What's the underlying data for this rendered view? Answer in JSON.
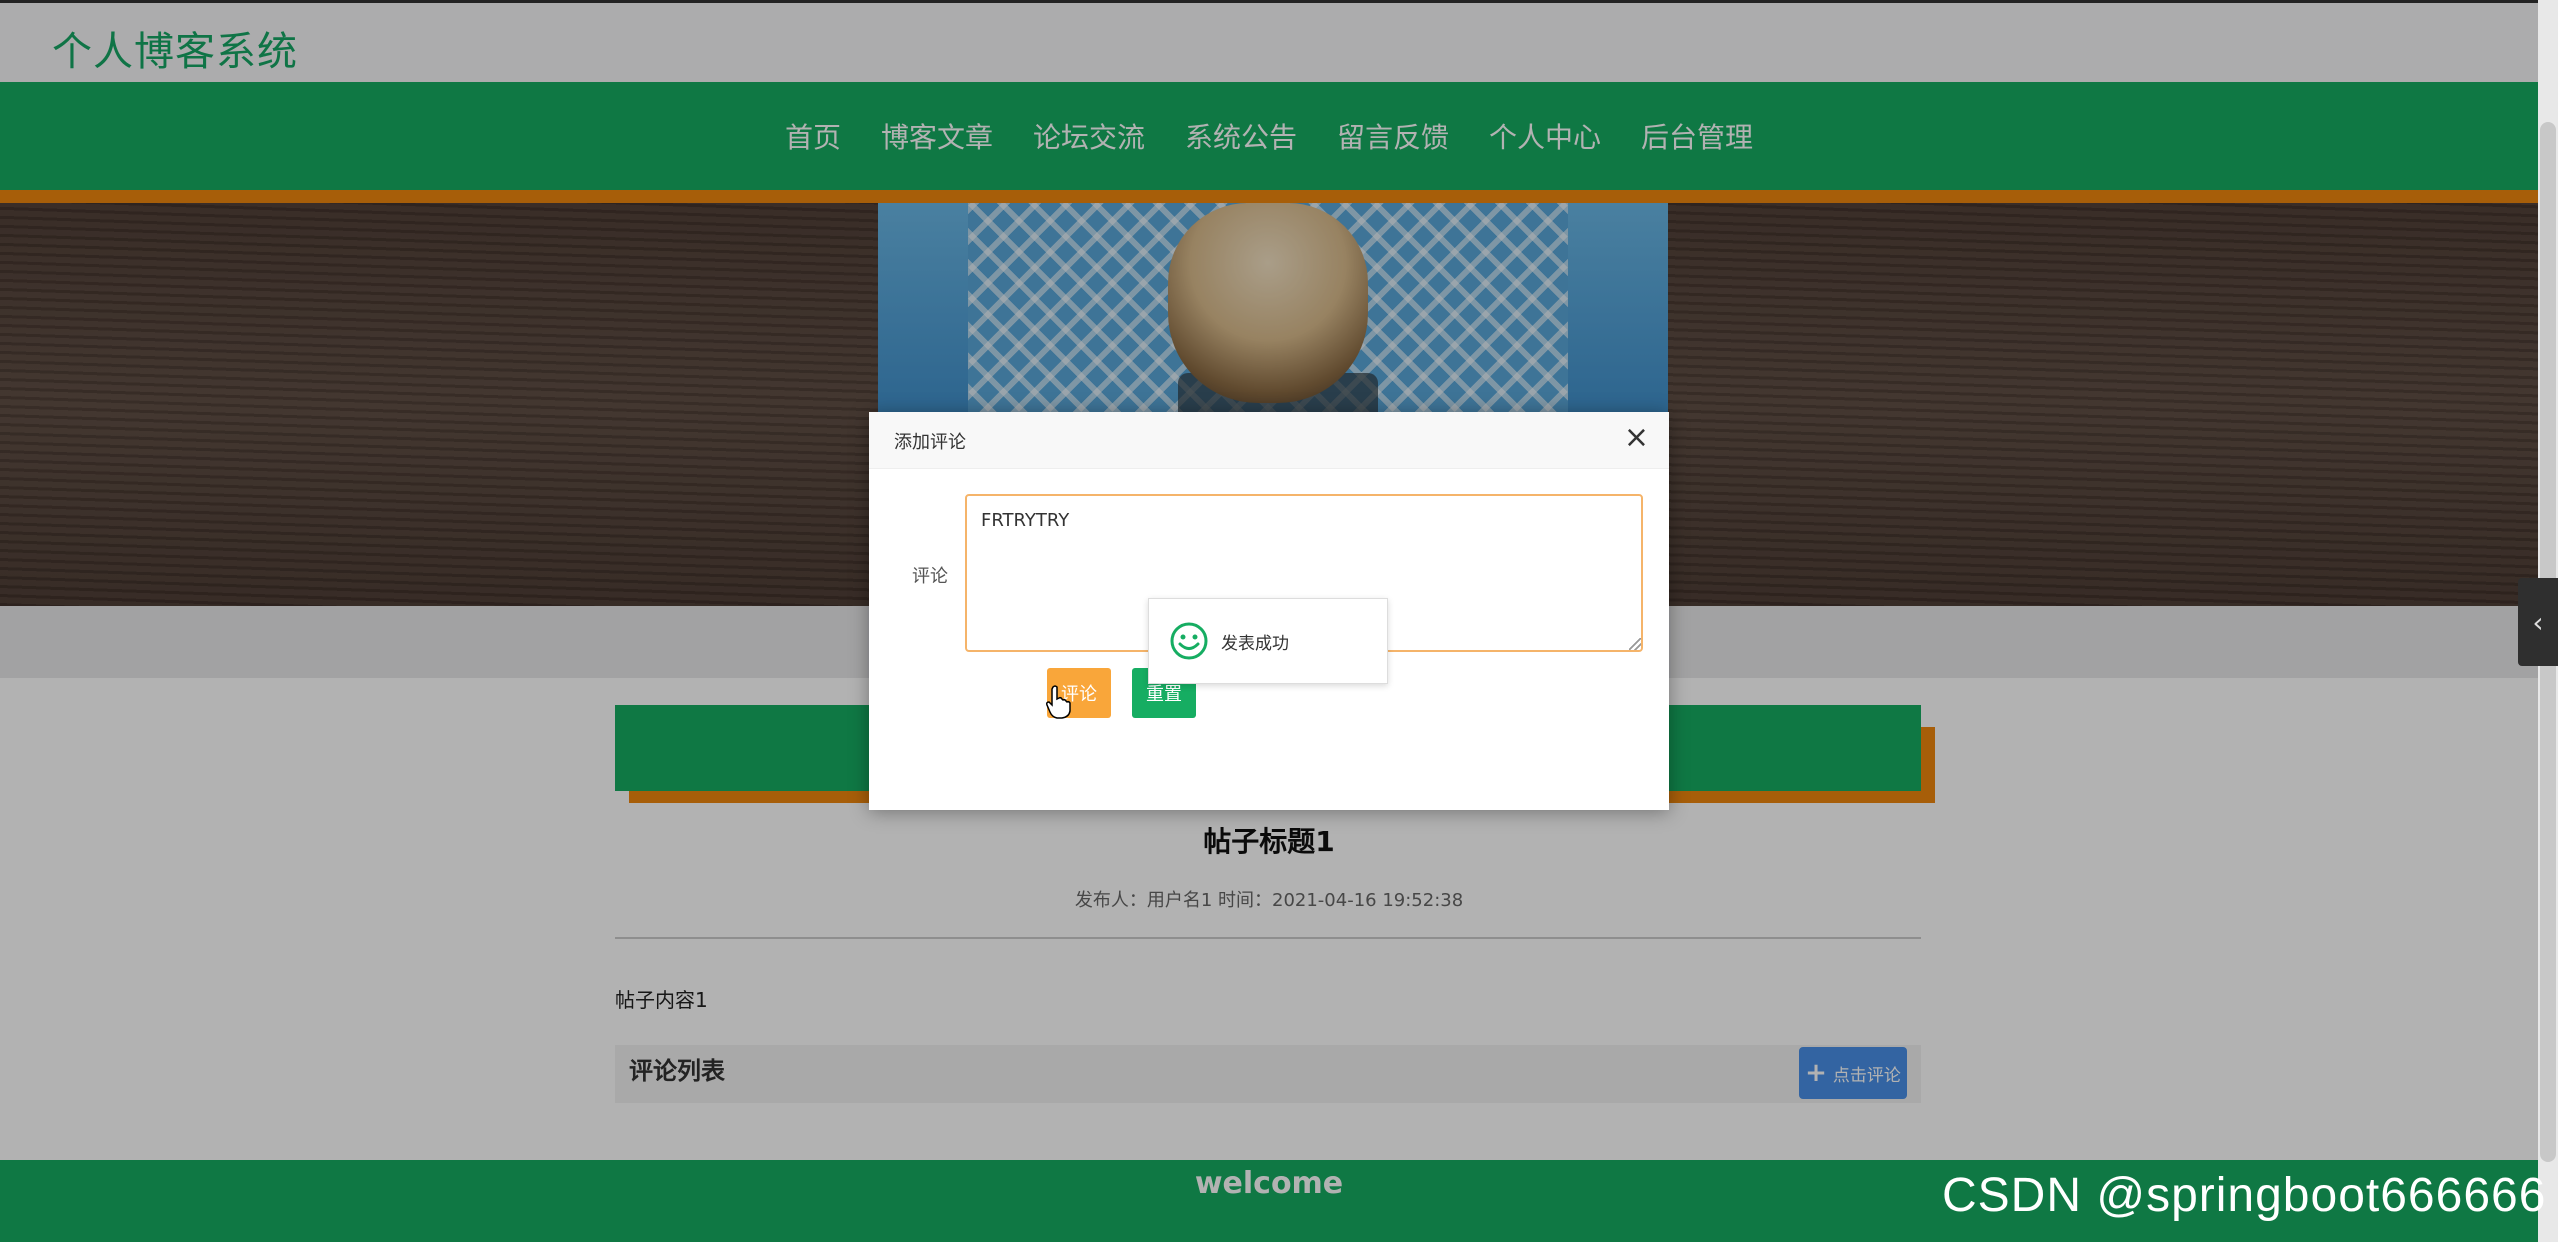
{
  "header": {
    "logo": "个人博客系统"
  },
  "nav": {
    "items": [
      "首页",
      "博客文章",
      "论坛交流",
      "系统公告",
      "留言反馈",
      "个人中心",
      "后台管理"
    ]
  },
  "post": {
    "title": "帖子标题1",
    "meta": "发布人：用户名1 时间：2021-04-16 19:52:38",
    "content": "帖子内容1"
  },
  "comments": {
    "section_title": "评论列表",
    "add_button_label": "点击评论"
  },
  "footer": {
    "text": "welcome"
  },
  "watermark": "CSDN @springboot666666",
  "dialog": {
    "title": "添加评论",
    "field_label": "评论",
    "field_value": "FRTRYTRY",
    "submit_label": "评论",
    "reset_label": "重置"
  },
  "toast": {
    "message": "发表成功",
    "icon": "smile-icon"
  },
  "colors": {
    "primary_green": "#16ad62",
    "accent_orange": "#f0870d",
    "submit_orange": "#f9a63a",
    "button_blue": "#4a90e8"
  }
}
